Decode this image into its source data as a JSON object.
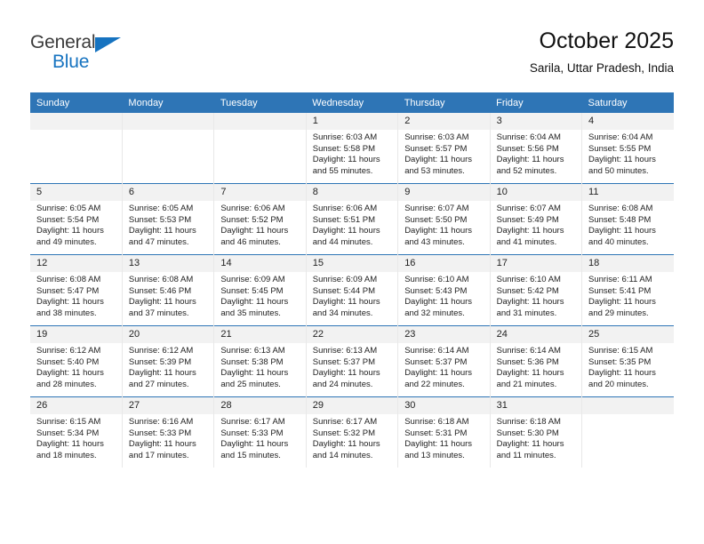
{
  "brand": {
    "name_part1": "General",
    "name_part2": "Blue",
    "accent_color": "#1673c0"
  },
  "header": {
    "title": "October 2025",
    "subtitle": "Sarila, Uttar Pradesh, India"
  },
  "theme": {
    "header_bg": "#2e75b6",
    "daynum_bg": "#f2f2f2"
  },
  "weekday_headers": [
    "Sunday",
    "Monday",
    "Tuesday",
    "Wednesday",
    "Thursday",
    "Friday",
    "Saturday"
  ],
  "weeks": [
    [
      {
        "day": "",
        "empty": true,
        "sunrise": "",
        "sunset": "",
        "daylight": ""
      },
      {
        "day": "",
        "empty": true,
        "sunrise": "",
        "sunset": "",
        "daylight": ""
      },
      {
        "day": "",
        "empty": true,
        "sunrise": "",
        "sunset": "",
        "daylight": ""
      },
      {
        "day": "1",
        "sunrise": "Sunrise: 6:03 AM",
        "sunset": "Sunset: 5:58 PM",
        "daylight": "Daylight: 11 hours and 55 minutes."
      },
      {
        "day": "2",
        "sunrise": "Sunrise: 6:03 AM",
        "sunset": "Sunset: 5:57 PM",
        "daylight": "Daylight: 11 hours and 53 minutes."
      },
      {
        "day": "3",
        "sunrise": "Sunrise: 6:04 AM",
        "sunset": "Sunset: 5:56 PM",
        "daylight": "Daylight: 11 hours and 52 minutes."
      },
      {
        "day": "4",
        "sunrise": "Sunrise: 6:04 AM",
        "sunset": "Sunset: 5:55 PM",
        "daylight": "Daylight: 11 hours and 50 minutes."
      }
    ],
    [
      {
        "day": "5",
        "sunrise": "Sunrise: 6:05 AM",
        "sunset": "Sunset: 5:54 PM",
        "daylight": "Daylight: 11 hours and 49 minutes."
      },
      {
        "day": "6",
        "sunrise": "Sunrise: 6:05 AM",
        "sunset": "Sunset: 5:53 PM",
        "daylight": "Daylight: 11 hours and 47 minutes."
      },
      {
        "day": "7",
        "sunrise": "Sunrise: 6:06 AM",
        "sunset": "Sunset: 5:52 PM",
        "daylight": "Daylight: 11 hours and 46 minutes."
      },
      {
        "day": "8",
        "sunrise": "Sunrise: 6:06 AM",
        "sunset": "Sunset: 5:51 PM",
        "daylight": "Daylight: 11 hours and 44 minutes."
      },
      {
        "day": "9",
        "sunrise": "Sunrise: 6:07 AM",
        "sunset": "Sunset: 5:50 PM",
        "daylight": "Daylight: 11 hours and 43 minutes."
      },
      {
        "day": "10",
        "sunrise": "Sunrise: 6:07 AM",
        "sunset": "Sunset: 5:49 PM",
        "daylight": "Daylight: 11 hours and 41 minutes."
      },
      {
        "day": "11",
        "sunrise": "Sunrise: 6:08 AM",
        "sunset": "Sunset: 5:48 PM",
        "daylight": "Daylight: 11 hours and 40 minutes."
      }
    ],
    [
      {
        "day": "12",
        "sunrise": "Sunrise: 6:08 AM",
        "sunset": "Sunset: 5:47 PM",
        "daylight": "Daylight: 11 hours and 38 minutes."
      },
      {
        "day": "13",
        "sunrise": "Sunrise: 6:08 AM",
        "sunset": "Sunset: 5:46 PM",
        "daylight": "Daylight: 11 hours and 37 minutes."
      },
      {
        "day": "14",
        "sunrise": "Sunrise: 6:09 AM",
        "sunset": "Sunset: 5:45 PM",
        "daylight": "Daylight: 11 hours and 35 minutes."
      },
      {
        "day": "15",
        "sunrise": "Sunrise: 6:09 AM",
        "sunset": "Sunset: 5:44 PM",
        "daylight": "Daylight: 11 hours and 34 minutes."
      },
      {
        "day": "16",
        "sunrise": "Sunrise: 6:10 AM",
        "sunset": "Sunset: 5:43 PM",
        "daylight": "Daylight: 11 hours and 32 minutes."
      },
      {
        "day": "17",
        "sunrise": "Sunrise: 6:10 AM",
        "sunset": "Sunset: 5:42 PM",
        "daylight": "Daylight: 11 hours and 31 minutes."
      },
      {
        "day": "18",
        "sunrise": "Sunrise: 6:11 AM",
        "sunset": "Sunset: 5:41 PM",
        "daylight": "Daylight: 11 hours and 29 minutes."
      }
    ],
    [
      {
        "day": "19",
        "sunrise": "Sunrise: 6:12 AM",
        "sunset": "Sunset: 5:40 PM",
        "daylight": "Daylight: 11 hours and 28 minutes."
      },
      {
        "day": "20",
        "sunrise": "Sunrise: 6:12 AM",
        "sunset": "Sunset: 5:39 PM",
        "daylight": "Daylight: 11 hours and 27 minutes."
      },
      {
        "day": "21",
        "sunrise": "Sunrise: 6:13 AM",
        "sunset": "Sunset: 5:38 PM",
        "daylight": "Daylight: 11 hours and 25 minutes."
      },
      {
        "day": "22",
        "sunrise": "Sunrise: 6:13 AM",
        "sunset": "Sunset: 5:37 PM",
        "daylight": "Daylight: 11 hours and 24 minutes."
      },
      {
        "day": "23",
        "sunrise": "Sunrise: 6:14 AM",
        "sunset": "Sunset: 5:37 PM",
        "daylight": "Daylight: 11 hours and 22 minutes."
      },
      {
        "day": "24",
        "sunrise": "Sunrise: 6:14 AM",
        "sunset": "Sunset: 5:36 PM",
        "daylight": "Daylight: 11 hours and 21 minutes."
      },
      {
        "day": "25",
        "sunrise": "Sunrise: 6:15 AM",
        "sunset": "Sunset: 5:35 PM",
        "daylight": "Daylight: 11 hours and 20 minutes."
      }
    ],
    [
      {
        "day": "26",
        "sunrise": "Sunrise: 6:15 AM",
        "sunset": "Sunset: 5:34 PM",
        "daylight": "Daylight: 11 hours and 18 minutes."
      },
      {
        "day": "27",
        "sunrise": "Sunrise: 6:16 AM",
        "sunset": "Sunset: 5:33 PM",
        "daylight": "Daylight: 11 hours and 17 minutes."
      },
      {
        "day": "28",
        "sunrise": "Sunrise: 6:17 AM",
        "sunset": "Sunset: 5:33 PM",
        "daylight": "Daylight: 11 hours and 15 minutes."
      },
      {
        "day": "29",
        "sunrise": "Sunrise: 6:17 AM",
        "sunset": "Sunset: 5:32 PM",
        "daylight": "Daylight: 11 hours and 14 minutes."
      },
      {
        "day": "30",
        "sunrise": "Sunrise: 6:18 AM",
        "sunset": "Sunset: 5:31 PM",
        "daylight": "Daylight: 11 hours and 13 minutes."
      },
      {
        "day": "31",
        "sunrise": "Sunrise: 6:18 AM",
        "sunset": "Sunset: 5:30 PM",
        "daylight": "Daylight: 11 hours and 11 minutes."
      },
      {
        "day": "",
        "empty": true,
        "sunrise": "",
        "sunset": "",
        "daylight": ""
      }
    ]
  ]
}
